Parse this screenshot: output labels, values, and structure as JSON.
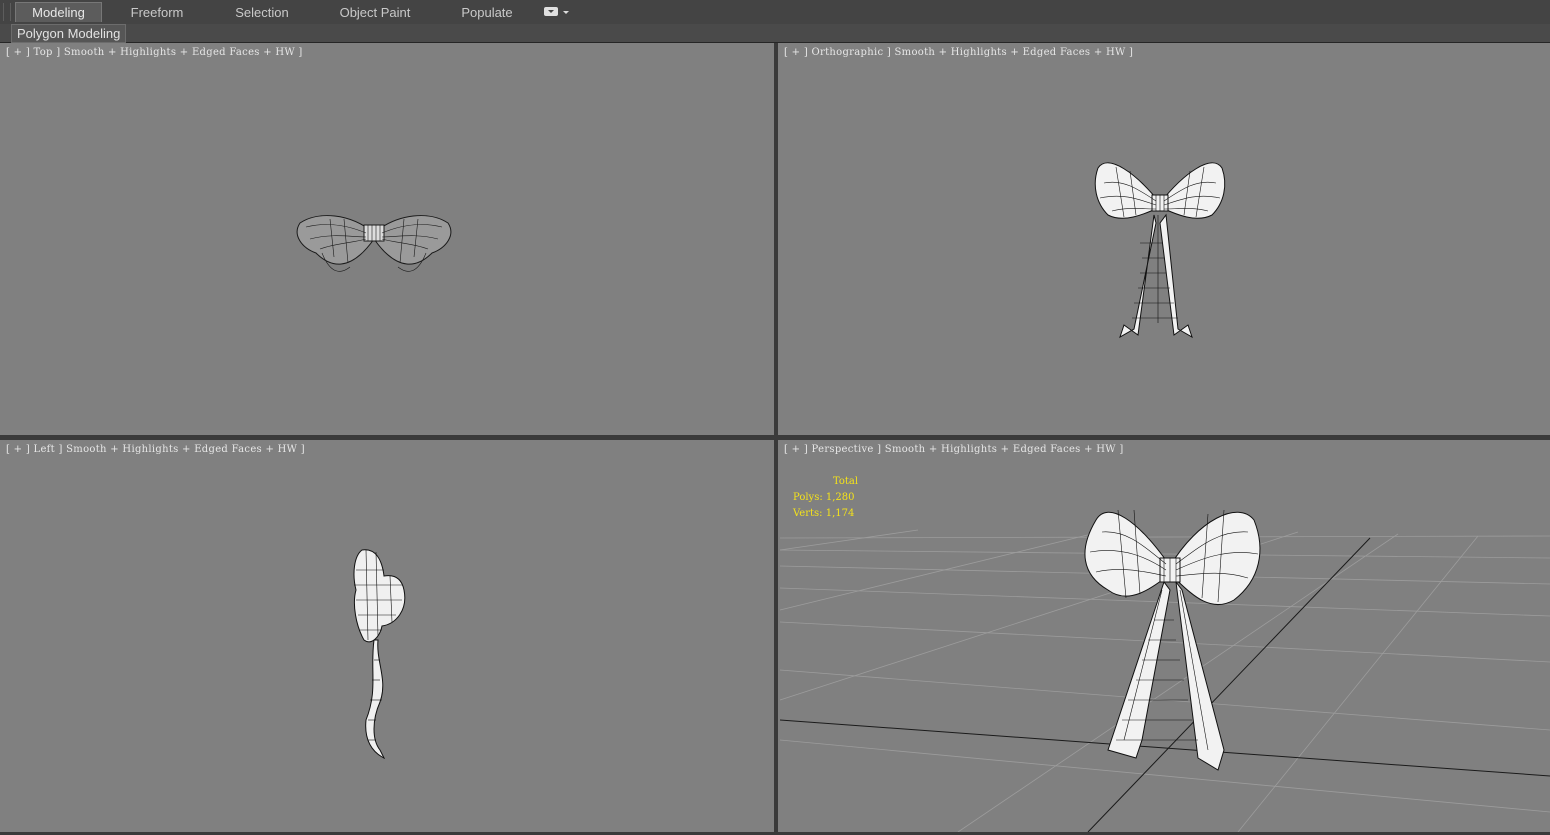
{
  "ribbon": {
    "tabs": [
      {
        "label": "Modeling",
        "active": true
      },
      {
        "label": "Freeform",
        "active": false
      },
      {
        "label": "Selection",
        "active": false
      },
      {
        "label": "Object Paint",
        "active": false
      },
      {
        "label": "Populate",
        "active": false
      }
    ],
    "panel_label": "Polygon Modeling"
  },
  "viewports": {
    "top": {
      "label": "[ + ] Top ] Smooth + Highlights + Edged Faces + HW ]"
    },
    "ortho": {
      "label": "[ + ] Orthographic ] Smooth + Highlights + Edged Faces + HW ]"
    },
    "left": {
      "label": "[ + ] Left ] Smooth + Highlights + Edged Faces + HW ]"
    },
    "persp": {
      "label": "[ + ] Perspective ] Smooth + Highlights + Edged Faces + HW ]"
    }
  },
  "stats": {
    "title": "Total",
    "polys": "Polys: 1,280",
    "verts": "Verts: 1,174"
  },
  "colors": {
    "viewport_bg": "#808080",
    "stats_text": "#f4e21a",
    "ui_bg": "#444444"
  }
}
